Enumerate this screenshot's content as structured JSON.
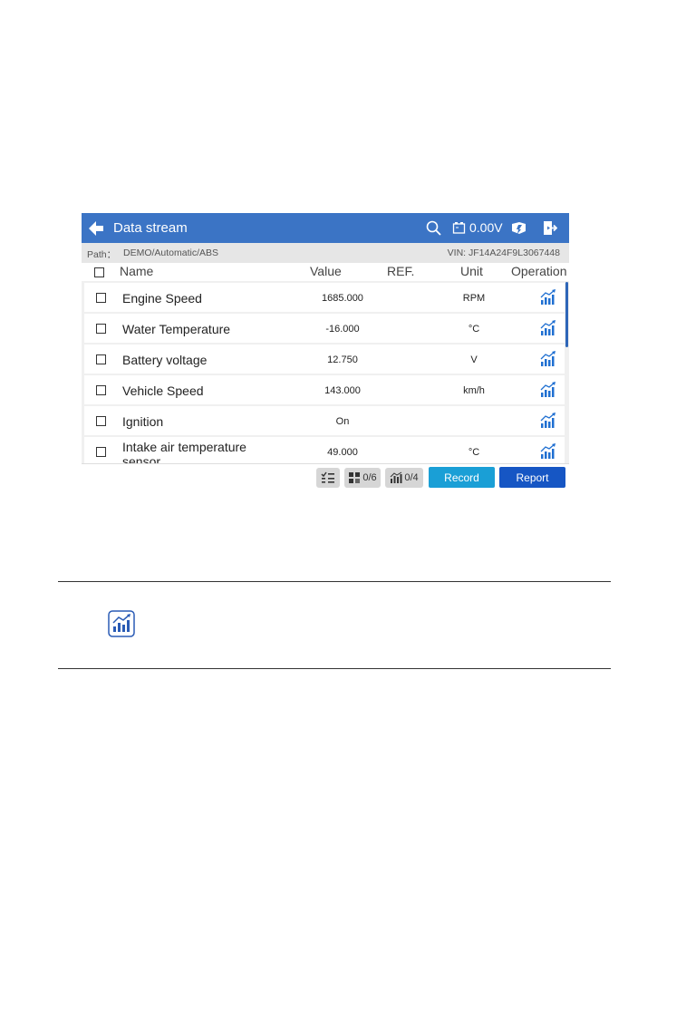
{
  "app": {
    "title": "Data stream",
    "voltage": "0.00V"
  },
  "path": {
    "label": "Path：",
    "value": "DEMO/Automatic/ABS",
    "vin": "VIN: JF14A24F9L3067448"
  },
  "columns": {
    "name": "Name",
    "value": "Value",
    "ref": "REF.",
    "unit": "Unit",
    "operation": "Operation"
  },
  "rows": [
    {
      "name": "Engine Speed",
      "value": "1685.000",
      "unit": "RPM"
    },
    {
      "name": "Water Temperature",
      "value": "-16.000",
      "unit": "°C"
    },
    {
      "name": "Battery voltage",
      "value": "12.750",
      "unit": "V"
    },
    {
      "name": "Vehicle Speed",
      "value": "143.000",
      "unit": "km/h"
    },
    {
      "name": "Ignition",
      "value": "On",
      "unit": ""
    },
    {
      "name": "Intake air temperature sensor",
      "value": "49.000",
      "unit": "°C"
    }
  ],
  "toolbar": {
    "combine_count": "0/6",
    "graph_count": "0/4",
    "record_label": "Record",
    "report_label": "Report"
  },
  "colors": {
    "titlebar": "#3b74c5",
    "record": "#1a9fd6",
    "report": "#1656c4",
    "graph_icon": "#1f6fd1"
  }
}
